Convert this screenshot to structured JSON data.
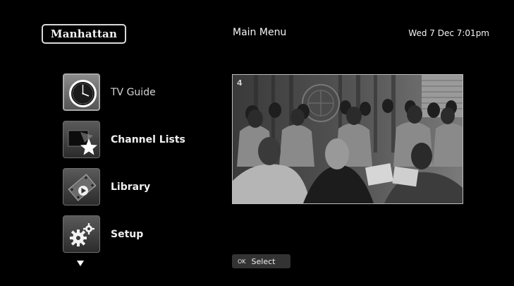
{
  "header": {
    "logo": "Manhattan",
    "title": "Main Menu",
    "datetime": "Wed 7 Dec 7:01pm"
  },
  "menu": {
    "items": [
      {
        "label": "TV Guide",
        "icon": "clock-icon",
        "selected": true
      },
      {
        "label": "Channel Lists",
        "icon": "star-icon",
        "selected": false
      },
      {
        "label": "Library",
        "icon": "film-icon",
        "selected": false
      },
      {
        "label": "Setup",
        "icon": "gears-icon",
        "selected": false
      }
    ]
  },
  "preview": {
    "channel_badge": "4",
    "description": "live tv preview"
  },
  "footer": {
    "key": "OK",
    "action": "Select"
  }
}
